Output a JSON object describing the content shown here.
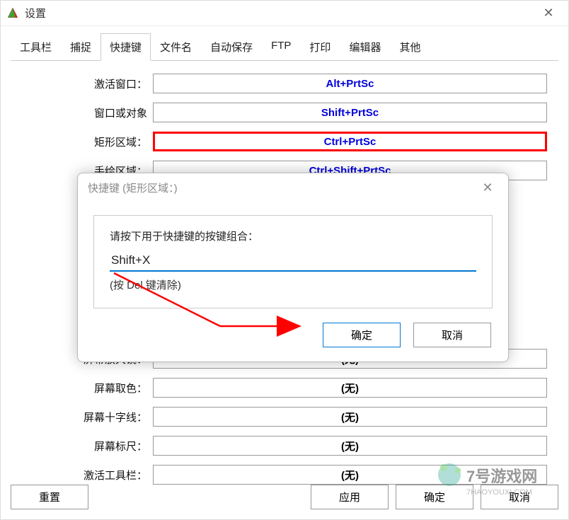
{
  "window": {
    "title": "设置"
  },
  "tabs": [
    {
      "label": "工具栏"
    },
    {
      "label": "捕捉"
    },
    {
      "label": "快捷键"
    },
    {
      "label": "文件名"
    },
    {
      "label": "自动保存"
    },
    {
      "label": "FTP"
    },
    {
      "label": "打印"
    },
    {
      "label": "编辑器"
    },
    {
      "label": "其他"
    }
  ],
  "rows": [
    {
      "label": "激活窗口：",
      "value": "Alt+PrtSc",
      "blue": true
    },
    {
      "label": "窗口或对象",
      "value": "Shift+PrtSc",
      "blue": true
    },
    {
      "label": "矩形区域：",
      "value": "Ctrl+PrtSc",
      "blue": true,
      "highlight": true
    },
    {
      "label": "手绘区域：",
      "value": "Ctrl+Shift+PrtSc",
      "blue": true
    },
    {
      "label": "",
      "value": ""
    },
    {
      "label": "",
      "value": ""
    },
    {
      "label": "",
      "value": ""
    },
    {
      "label": "",
      "value": ""
    },
    {
      "label": "",
      "value": ""
    },
    {
      "label": "屏幕放大镜：",
      "value": "(无)"
    },
    {
      "label": "屏幕取色：",
      "value": "(无)"
    },
    {
      "label": "屏幕十字线：",
      "value": "(无)"
    },
    {
      "label": "屏幕标尺：",
      "value": "(无)"
    },
    {
      "label": "激活工具栏：",
      "value": "(无)"
    }
  ],
  "buttons": {
    "reset": "重置",
    "apply": "应用",
    "ok": "确定",
    "cancel": "取消"
  },
  "modal": {
    "title": "快捷键 (矩形区域：)",
    "instruction": "请按下用于快捷键的按键组合：",
    "input_value": "Shift+X",
    "hint": "(按 Del 键清除)",
    "ok": "确定",
    "cancel": "取消"
  },
  "watermark": {
    "text1": "7号游戏网",
    "text2": "7HAOYOUXI.COM"
  }
}
